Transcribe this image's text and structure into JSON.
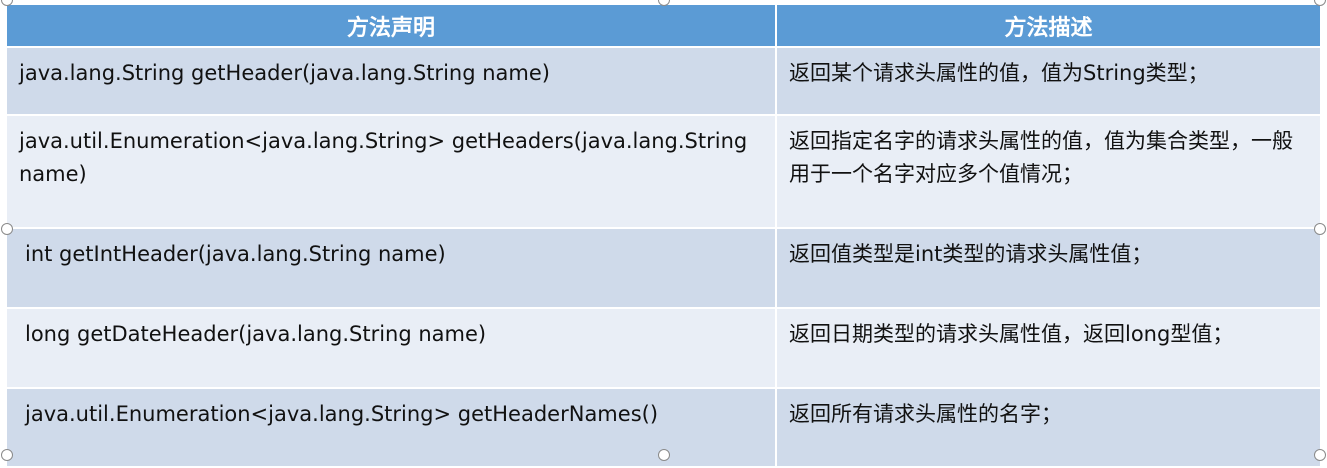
{
  "table": {
    "headers": [
      "方法声明",
      "方法描述"
    ],
    "rows": [
      {
        "declaration": "java.lang.String getHeader(java.lang.String name)",
        "description": "返回某个请求头属性的值，值为String类型；"
      },
      {
        "declaration": "java.util.Enumeration<java.lang.String> getHeaders(java.lang.String name)",
        "description": "返回指定名字的请求头属性的值，值为集合类型，一般用于一个名字对应多个值情况；"
      },
      {
        "declaration": "int getIntHeader(java.lang.String name)",
        "description": "返回值类型是int类型的请求头属性值；"
      },
      {
        "declaration": "long getDateHeader(java.lang.String name)",
        "description": "返回日期类型的请求头属性值，返回long型值；"
      },
      {
        "declaration": "java.util.Enumeration<java.lang.String> getHeaderNames()",
        "description": "返回所有请求头属性的名字；"
      }
    ]
  },
  "colors": {
    "header_bg": "#5b9bd5",
    "row_odd_bg": "#cfdaea",
    "row_even_bg": "#e9eef6"
  }
}
